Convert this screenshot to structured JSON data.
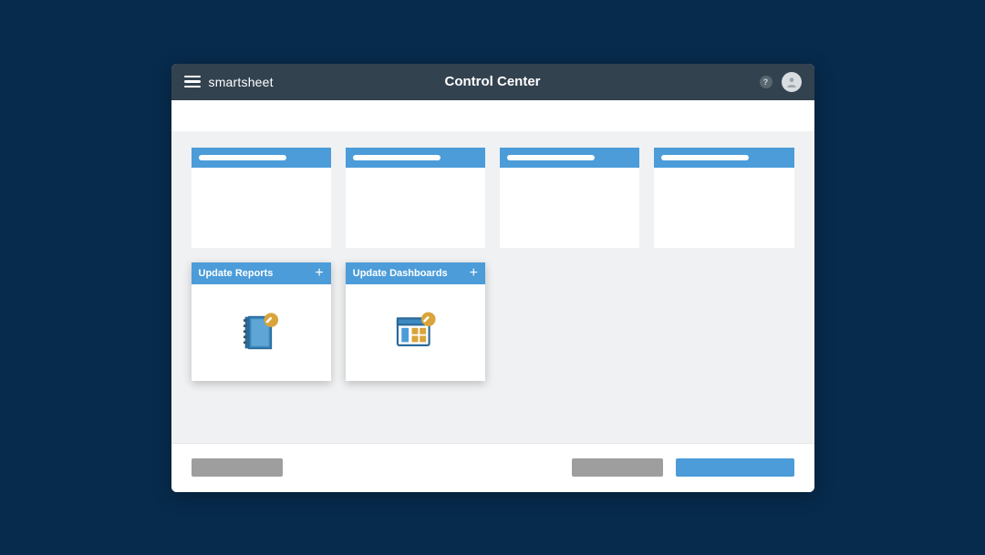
{
  "header": {
    "brand": "smartsheet",
    "title": "Control Center",
    "help": "?"
  },
  "tiles": {
    "row1": [
      {
        "placeholder": true
      },
      {
        "placeholder": true
      },
      {
        "placeholder": true
      },
      {
        "placeholder": true
      }
    ],
    "row2": [
      {
        "label": "Update Reports",
        "icon": "report-edit"
      },
      {
        "label": "Update Dashboards",
        "icon": "dashboard-edit"
      }
    ]
  },
  "footer": {
    "left_label": "",
    "secondary_label": "",
    "primary_label": ""
  },
  "colors": {
    "accent": "#4b9cd9",
    "header_bg": "#33424f",
    "page_bg": "#072b4d",
    "badge": "#d9a43b"
  }
}
